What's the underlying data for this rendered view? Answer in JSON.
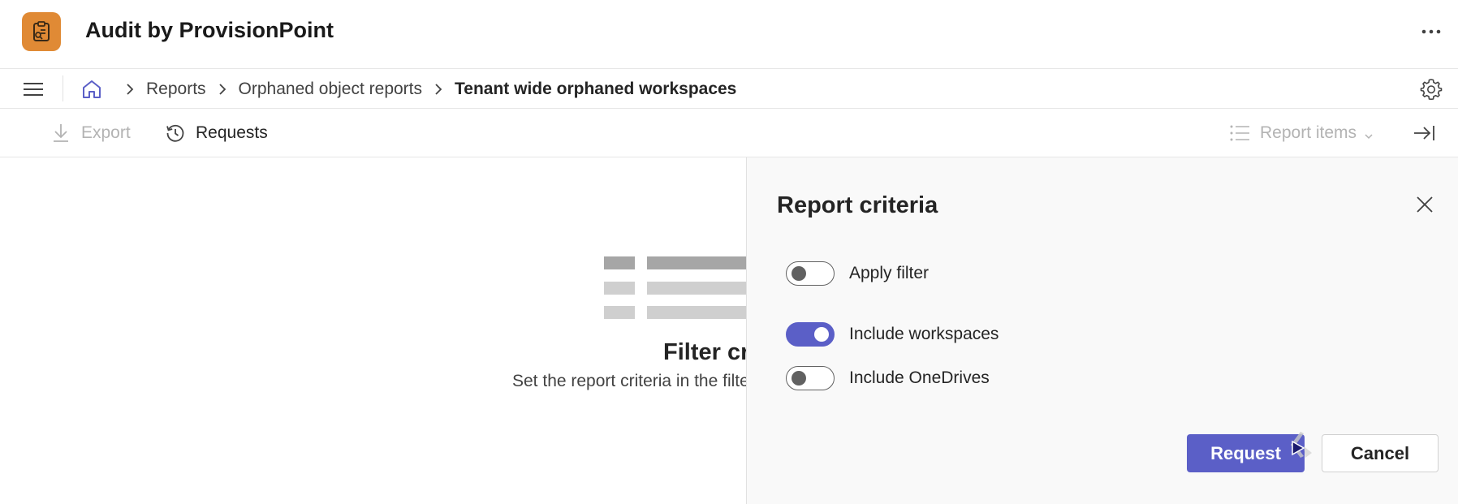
{
  "app": {
    "title": "Audit by ProvisionPoint",
    "icon": "clipboard-search-icon",
    "icon_color": "#e08a35"
  },
  "breadcrumb": {
    "items": [
      "Reports",
      "Orphaned object reports",
      "Tenant wide orphaned workspaces"
    ]
  },
  "toolbar": {
    "export_label": "Export",
    "requests_label": "Requests",
    "report_items_label": "Report items"
  },
  "empty_state": {
    "title": "Filter cr",
    "description": "Set the report criteria in the filte"
  },
  "panel": {
    "title": "Report criteria",
    "toggles": [
      {
        "label": "Apply filter",
        "checked": false
      },
      {
        "label": "Include workspaces",
        "checked": true
      },
      {
        "label": "Include OneDrives",
        "checked": false
      }
    ],
    "request_label": "Request",
    "cancel_label": "Cancel"
  },
  "colors": {
    "accent": "#5b5fc7",
    "panel_background": "#f9f9f9",
    "disabled_text": "#b3b3b3"
  }
}
